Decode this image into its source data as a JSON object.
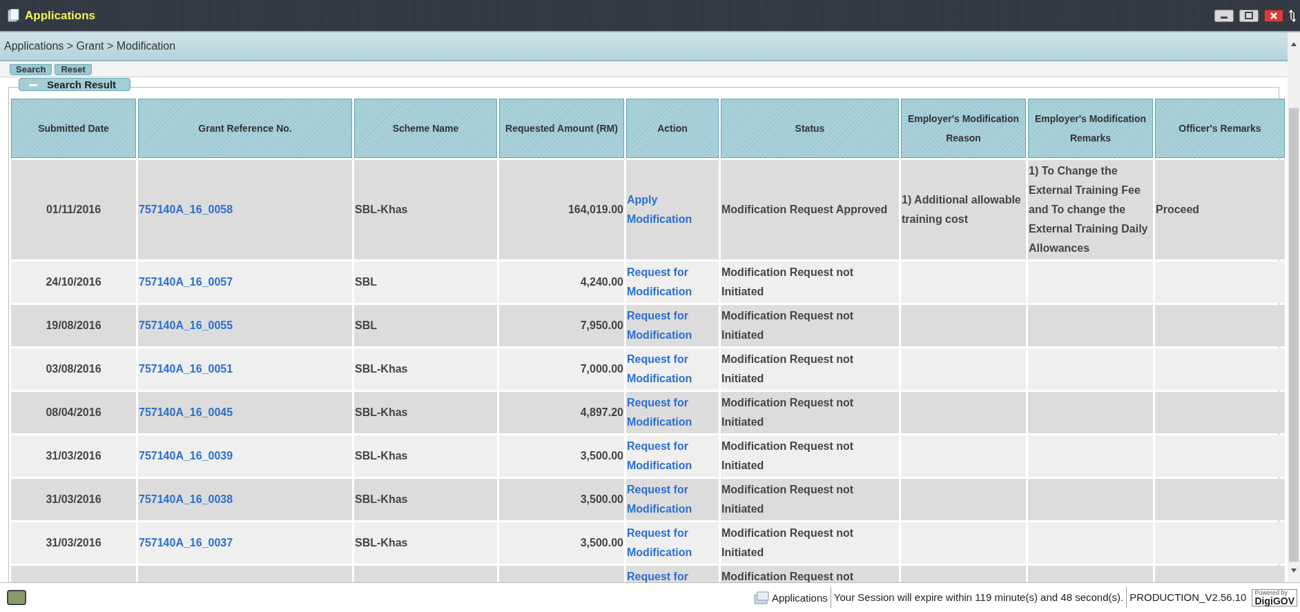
{
  "window": {
    "title": "Applications"
  },
  "breadcrumb": "Applications > Grant > Modification",
  "buttons": [
    "Search",
    "Reset"
  ],
  "section": {
    "title": "Search Result",
    "expanded": true
  },
  "table": {
    "columns": [
      "Submitted Date",
      "Grant Reference No.",
      "Scheme Name",
      "Requested Amount (RM)",
      "Action",
      "Status",
      "Employer's Modification Reason",
      "Employer's Modification Remarks",
      "Officer's Remarks"
    ],
    "rows": [
      {
        "cells": [
          "01/11/2016",
          "757140A_16_0058",
          "SBL-Khas",
          "164,019.00",
          "Apply Modification",
          "Modification Request Approved",
          "1) Additional allowable training cost",
          "1) To Change the External Training Fee and To change the External Training Daily Allowances",
          "Proceed"
        ]
      },
      {
        "cells": [
          "24/10/2016",
          "757140A_16_0057",
          "SBL",
          "4,240.00",
          "Request for Modification",
          "Modification Request not Initiated",
          null,
          null,
          null
        ]
      },
      {
        "cells": [
          "19/08/2016",
          "757140A_16_0055",
          "SBL",
          "7,950.00",
          "Request for Modification",
          "Modification Request not Initiated",
          null,
          null,
          null
        ]
      },
      {
        "cells": [
          "03/08/2016",
          "757140A_16_0051",
          "SBL-Khas",
          "7,000.00",
          "Request for Modification",
          "Modification Request not Initiated",
          null,
          null,
          null
        ]
      },
      {
        "cells": [
          "08/04/2016",
          "757140A_16_0045",
          "SBL-Khas",
          "4,897.20",
          "Request for Modification",
          "Modification Request not Initiated",
          null,
          null,
          null
        ]
      },
      {
        "cells": [
          "31/03/2016",
          "757140A_16_0039",
          "SBL-Khas",
          "3,500.00",
          "Request for Modification",
          "Modification Request not Initiated",
          null,
          null,
          null
        ]
      },
      {
        "cells": [
          "31/03/2016",
          "757140A_16_0038",
          "SBL-Khas",
          "3,500.00",
          "Request for Modification",
          "Modification Request not Initiated",
          null,
          null,
          null
        ]
      },
      {
        "cells": [
          "31/03/2016",
          "757140A_16_0037",
          "SBL-Khas",
          "3,500.00",
          "Request for Modification",
          "Modification Request not Initiated",
          null,
          null,
          null
        ]
      },
      {
        "cells": [
          null,
          null,
          null,
          null,
          "Request for",
          "Modification Request not",
          null,
          null,
          null
        ]
      }
    ]
  },
  "status_bar": {
    "app": "Applications",
    "session": "Your Session will expire within 119 minute(s) and 48 second(s).",
    "version": "PRODUCTION_V2.56.10",
    "logo_caption": "Powered by",
    "logo_text": "DigiGOV"
  }
}
